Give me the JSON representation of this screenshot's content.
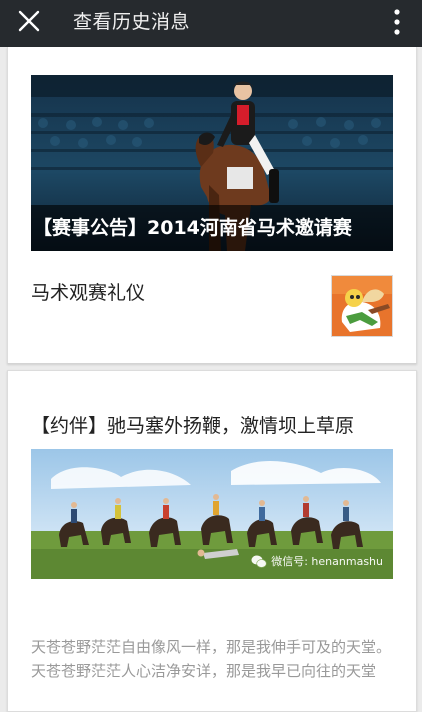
{
  "header": {
    "title": "查看历史消息",
    "close_icon": "close-icon",
    "more_icon": "more-vertical-icon",
    "background": "#262a2e"
  },
  "articles": [
    {
      "cover_caption": "【赛事公告】2014河南省马术邀请赛",
      "sub_item": {
        "title": "马术观赛礼仪"
      }
    },
    {
      "title": "【约伴】驰马塞外扬鞭，激情坝上草原",
      "watermark": "微信号: henanmashu",
      "excerpt": "天苍苍野茫茫自由像风一样，那是我伸手可及的天堂。天苍苍野茫茫人心洁净安详，那是我早已向往的天堂"
    }
  ]
}
